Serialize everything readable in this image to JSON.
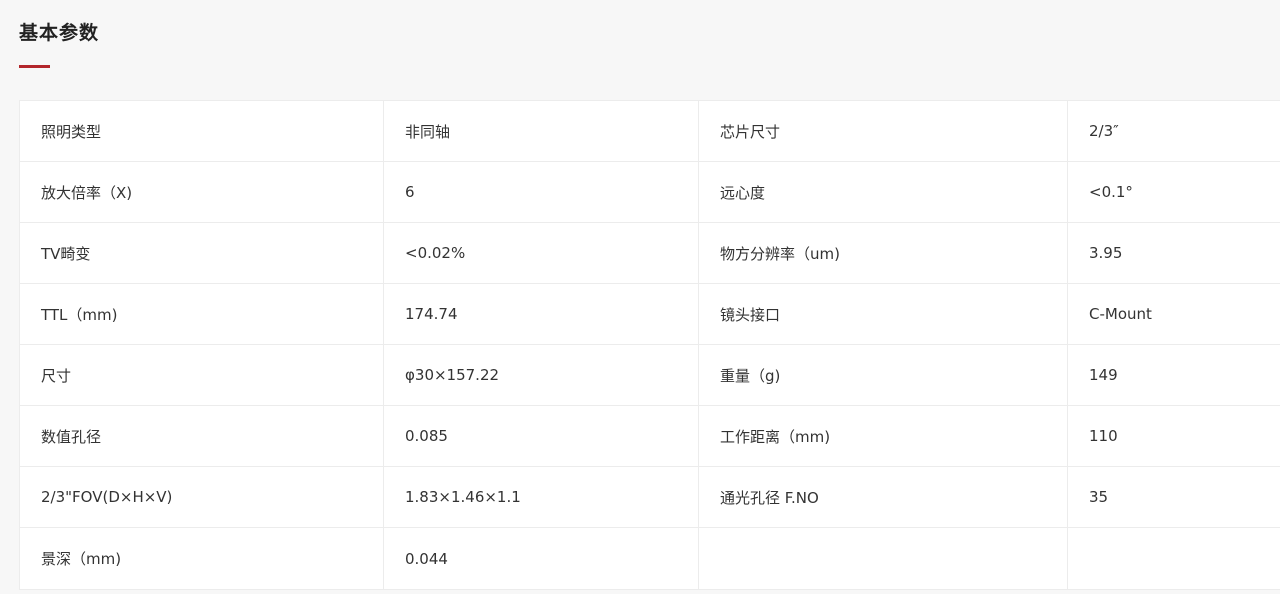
{
  "section": {
    "title": "基本参数"
  },
  "params": {
    "rows": [
      {
        "label1": "照明类型",
        "value1": "非同轴",
        "label2": "芯片尺寸",
        "value2": "2/3″"
      },
      {
        "label1": "放大倍率（X)",
        "value1": "6",
        "label2": "远心度",
        "value2": "<0.1°"
      },
      {
        "label1": "TV畸变",
        "value1": "<0.02%",
        "label2": "物方分辨率（um)",
        "value2": "3.95"
      },
      {
        "label1": "TTL（mm)",
        "value1": "174.74",
        "label2": "镜头接口",
        "value2": "C-Mount"
      },
      {
        "label1": "尺寸",
        "value1": "φ30×157.22",
        "label2": "重量（g)",
        "value2": "149"
      },
      {
        "label1": "数值孔径",
        "value1": "0.085",
        "label2": "工作距离（mm)",
        "value2": "110"
      },
      {
        "label1": "2/3\"FOV(D×H×V)",
        "value1": "1.83×1.46×1.1",
        "label2": "通光孔径 F.NO",
        "value2": "35"
      },
      {
        "label1": "景深（mm)",
        "value1": "0.044",
        "label2": "",
        "value2": ""
      }
    ]
  },
  "colors": {
    "accent": "#b3262b",
    "border": "#ececec",
    "text": "#333333",
    "page_background": "#f7f7f7",
    "table_background": "#ffffff"
  }
}
